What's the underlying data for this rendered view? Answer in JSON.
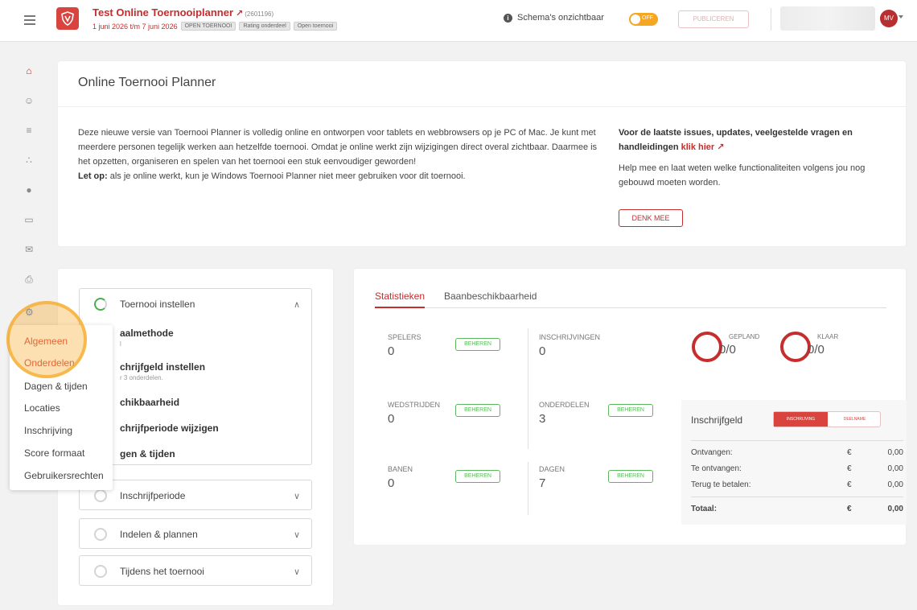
{
  "header": {
    "title": "Test Online Toernooiplanner",
    "tournament_id": "(2601196)",
    "dates": "1 juni 2026 t/m 7 juni 2026",
    "tags": [
      "OPEN TOERNOOI",
      "Rating onderdeel",
      "Open toernooi"
    ],
    "schema_visibility": "Schema's onzichtbaar",
    "toggle_label": "OFF",
    "publish_label": "PUBLICEREN",
    "avatar_initials": "MV"
  },
  "rail": {
    "icons": [
      "home-icon",
      "users-icon",
      "list-icon",
      "tree-icon",
      "ball-icon",
      "monitor-icon",
      "mail-icon",
      "print-icon",
      "gear-icon"
    ]
  },
  "intro": {
    "title": "Online Toernooi Planner",
    "paragraph": "Deze nieuwe versie van Toernooi Planner is volledig online en ontworpen voor tablets en webbrowsers op je PC of Mac. Je kunt met meerdere personen tegelijk werken aan hetzelfde toernooi. Omdat je online werkt zijn wijzigingen direct overal zichtbaar. Daarmee is het opzetten, organiseren en spelen van het toernooi een stuk eenvoudiger geworden!",
    "warning_label": "Let op:",
    "warning_text": "als je online werkt, kun je Windows Toernooi Planner niet meer gebruiken voor dit toernooi.",
    "right_heading": "Voor de laatste issues, updates, veelgestelde vragen en handleidingen",
    "right_link": "klik hier",
    "right_help": "Help mee en laat weten welke functionaliteiten volgens jou nog gebouwd moeten worden.",
    "denk_mee": "DENK MEE"
  },
  "steps": {
    "sections": [
      {
        "label": "Toernooi instellen",
        "expanded": true
      },
      {
        "label": "Inschrijfperiode",
        "expanded": false
      },
      {
        "label": "Indelen & plannen",
        "expanded": false
      },
      {
        "label": "Tijdens het toernooi",
        "expanded": false
      }
    ],
    "sub_items": [
      {
        "label": "aalmethode",
        "note": "l"
      },
      {
        "label": "chrijfgeld instellen",
        "note": "r 3 onderdelen."
      },
      {
        "label": "chikbaarheid",
        "note": ""
      },
      {
        "label": "chrijfperiode wijzigen",
        "note": ""
      },
      {
        "label": "gen & tijden",
        "note": ""
      }
    ]
  },
  "menu": {
    "items": [
      "Algemeen",
      "Onderdelen",
      "Dagen & tijden",
      "Locaties",
      "Inschrijving",
      "Score formaat",
      "Gebruikersrechten"
    ]
  },
  "stats": {
    "tabs": [
      "Statistieken",
      "Baanbeschikbaarheid"
    ],
    "beheren": "BEHEREN",
    "blocks": [
      {
        "label": "SPELERS",
        "value": "0"
      },
      {
        "label": "INSCHRIJVINGEN",
        "value": "0"
      },
      {
        "label": "WEDSTRIJDEN",
        "value": "0"
      },
      {
        "label": "ONDERDELEN",
        "value": "3"
      },
      {
        "label": "BANEN",
        "value": "0"
      },
      {
        "label": "DAGEN",
        "value": "7"
      }
    ],
    "rings": [
      {
        "label": "GEPLAND",
        "value": "0/0"
      },
      {
        "label": "KLAAR",
        "value": "0/0"
      }
    ]
  },
  "fee": {
    "title": "Inschrijfgeld",
    "tab_on": "INSCHRIJVING",
    "tab_off": "DEELNAME",
    "currency": "€",
    "rows": [
      {
        "label": "Ontvangen:",
        "amount": "0,00"
      },
      {
        "label": "Te ontvangen:",
        "amount": "0,00"
      },
      {
        "label": "Terug te betalen:",
        "amount": "0,00"
      }
    ],
    "total": {
      "label": "Totaal:",
      "amount": "0,00"
    }
  },
  "colors": {
    "brand": "#c62d2d",
    "accent": "#f5a623",
    "success": "#5cb85c"
  }
}
